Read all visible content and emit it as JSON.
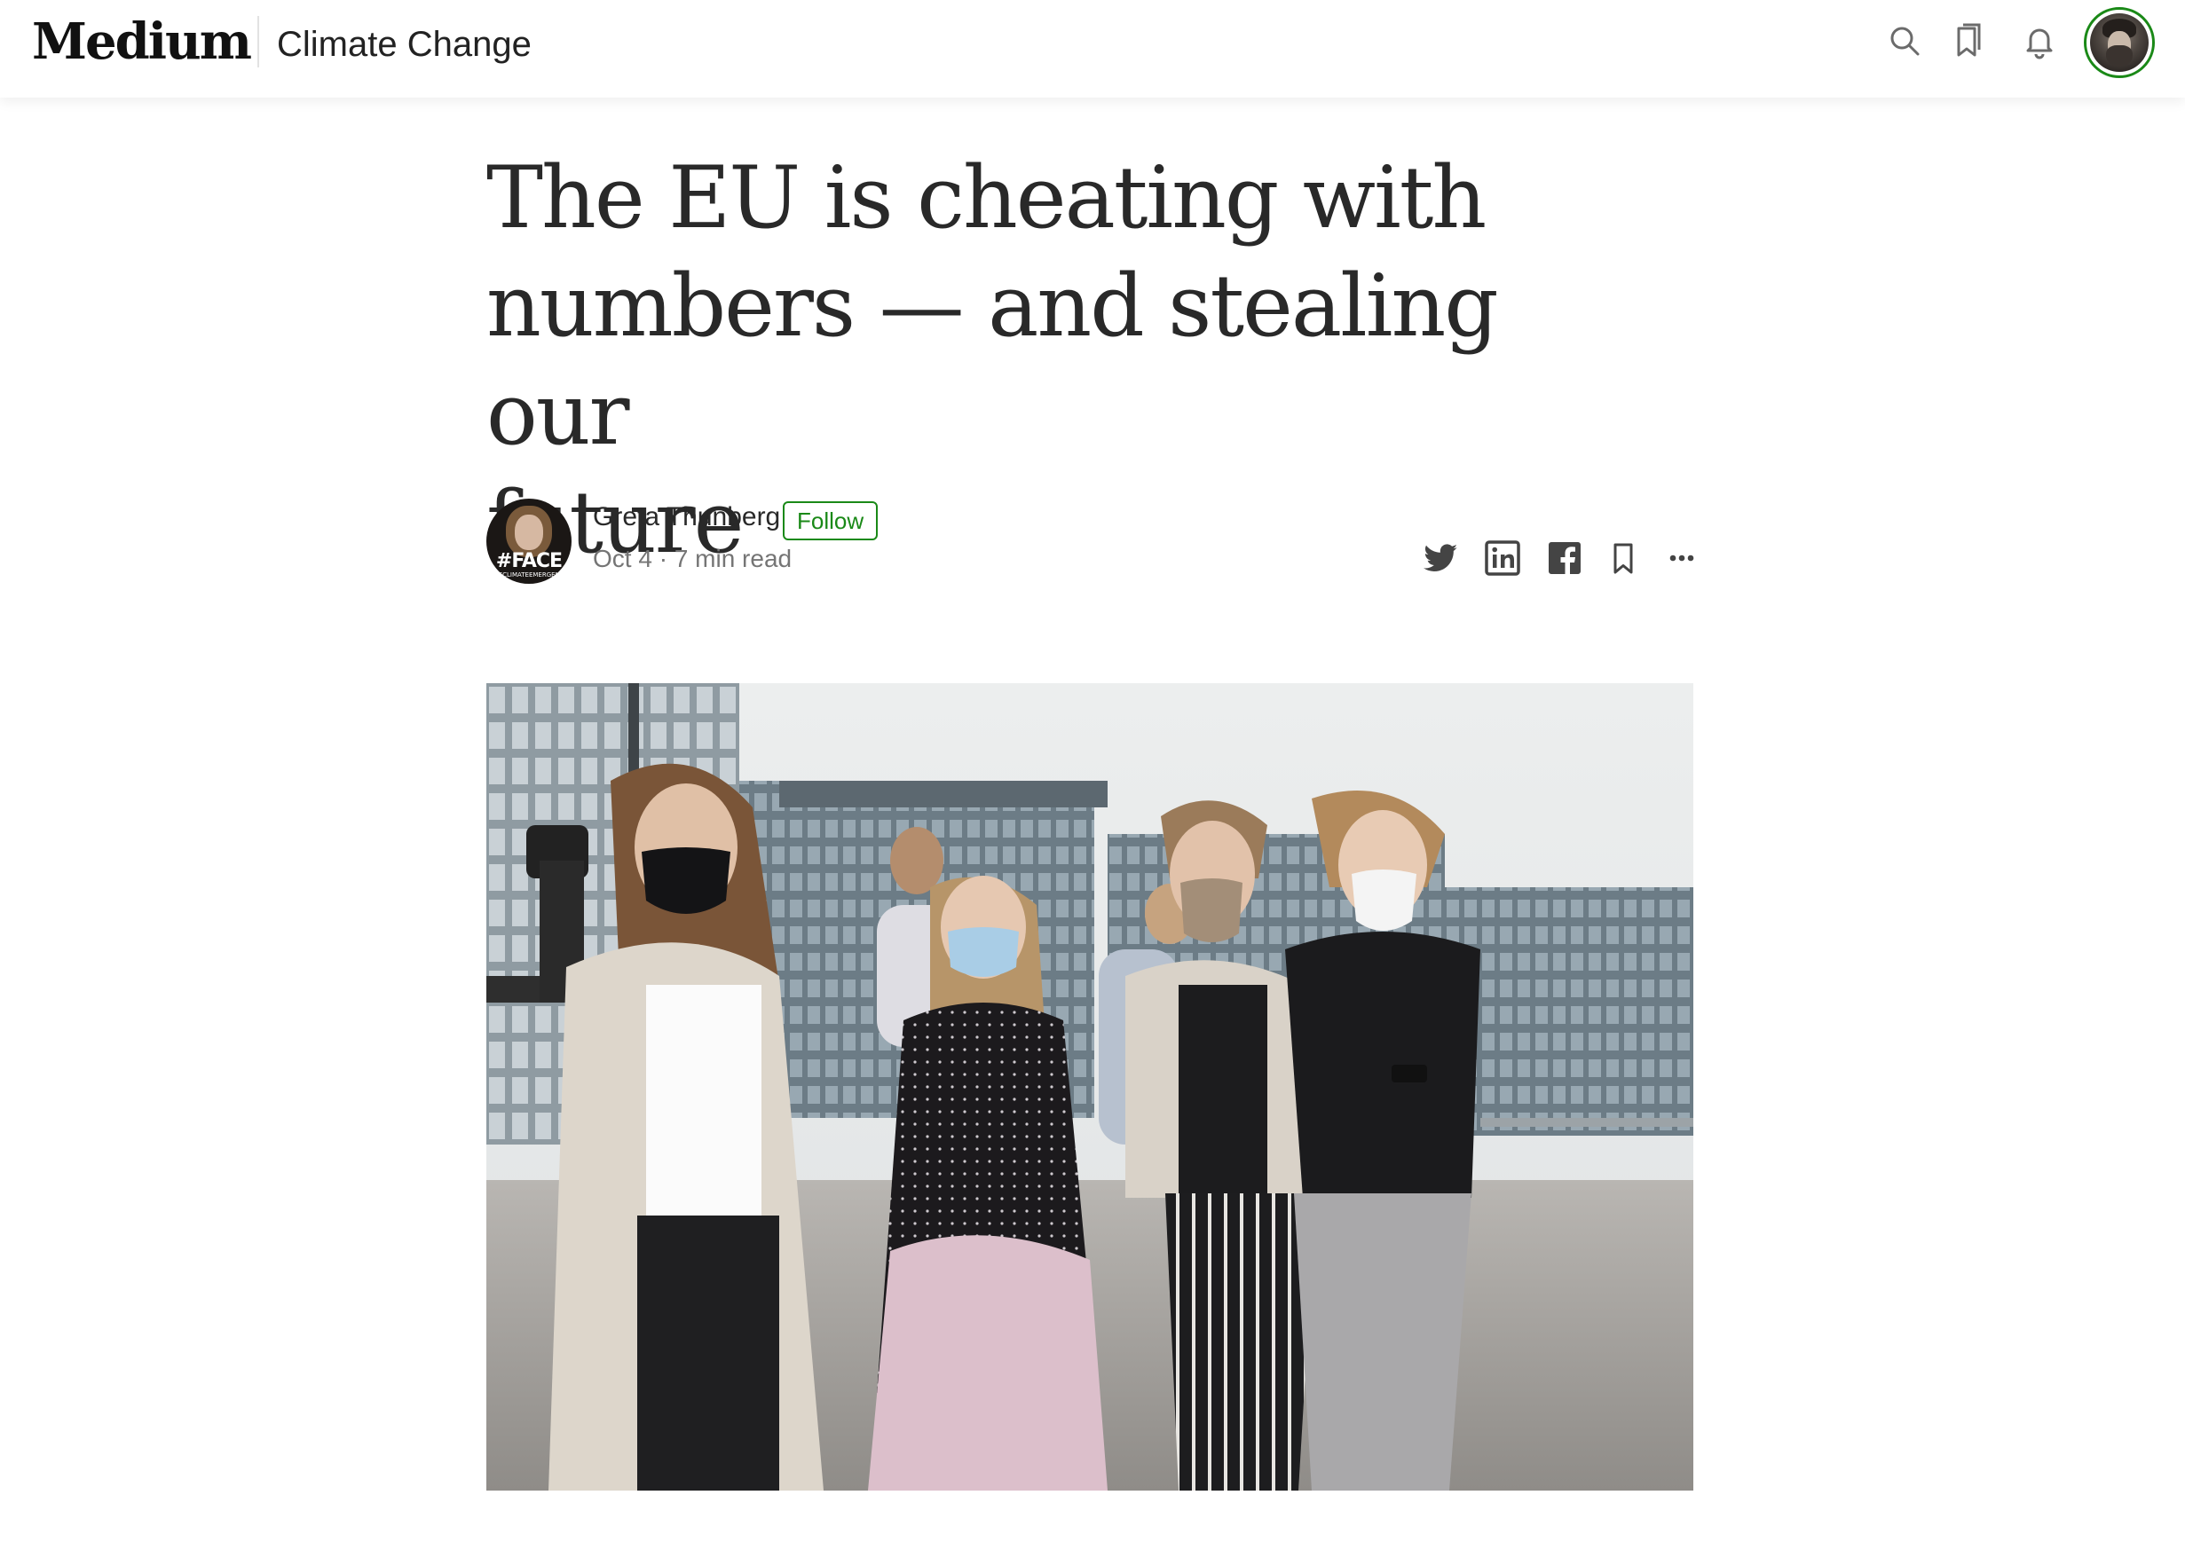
{
  "topbar": {
    "logo": "Medium",
    "publication": "Climate Change",
    "icons": [
      "search-icon",
      "bookmarks-icon",
      "bell-icon"
    ],
    "accent_color": "#1a8917"
  },
  "article": {
    "title_lines": [
      "The EU is cheating with",
      "numbers — and stealing our",
      "future"
    ],
    "author": {
      "name": "Greta Thunberg",
      "follow_label": "Follow",
      "avatar_text": "#FACE",
      "avatar_subtext": "THECLIMATEEMERGENCY"
    },
    "meta": {
      "date": "Oct 4",
      "separator": "·",
      "read_time": "7 min read"
    },
    "share_icons": [
      "twitter-icon",
      "linkedin-icon",
      "facebook-icon",
      "bookmark-icon",
      "more-icon"
    ],
    "hero_image": "people-walking-in-masks-photo"
  }
}
